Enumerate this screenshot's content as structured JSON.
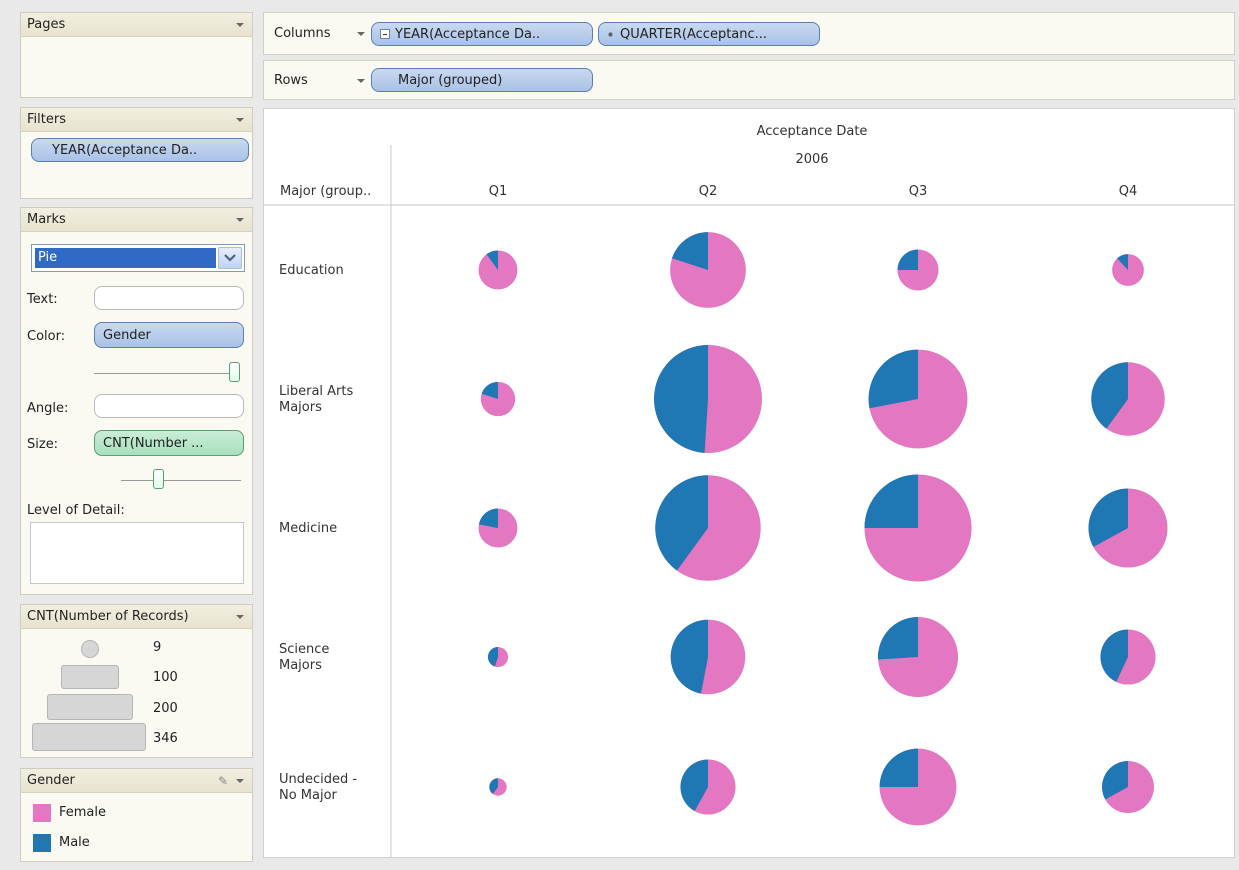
{
  "pages": {
    "title": "Pages"
  },
  "filters": {
    "title": "Filters",
    "pill": "YEAR(Acceptance Da.."
  },
  "marks": {
    "title": "Marks",
    "mark_type": "Pie",
    "text_label": "Text:",
    "color_label": "Color:",
    "color_pill": "Gender",
    "angle_label": "Angle:",
    "size_label": "Size:",
    "size_pill": "CNT(Number ...",
    "lod_label": "Level of Detail:"
  },
  "size_legend": {
    "title": "CNT(Number of Records)",
    "items": [
      "9",
      "100",
      "200",
      "346"
    ]
  },
  "gender_legend": {
    "title": "Gender",
    "items": [
      {
        "label": "Female",
        "color": "#e377c2"
      },
      {
        "label": "Male",
        "color": "#1f77b4"
      }
    ]
  },
  "shelves": {
    "columns_label": "Columns",
    "columns_pills": [
      "YEAR(Acceptance Da..",
      "QUARTER(Acceptanc..."
    ],
    "rows_label": "Rows",
    "rows_pills": [
      "Major (grouped)"
    ]
  },
  "chart_data": {
    "type": "pie",
    "title": "Acceptance Date",
    "year": "2006",
    "row_header": "Major (group..",
    "columns": [
      "Q1",
      "Q2",
      "Q3",
      "Q4"
    ],
    "rows": [
      "Education",
      "Liberal Arts Majors",
      "Medicine",
      "Science Majors",
      "Undecided - No Major"
    ],
    "series_colors": {
      "Female": "#e377c2",
      "Male": "#1f77b4"
    },
    "cells": [
      [
        {
          "count": 45,
          "male_fraction": 0.1
        },
        {
          "count": 170,
          "male_fraction": 0.2
        },
        {
          "count": 50,
          "male_fraction": 0.25
        },
        {
          "count": 30,
          "male_fraction": 0.12
        }
      ],
      [
        {
          "count": 35,
          "male_fraction": 0.2
        },
        {
          "count": 346,
          "male_fraction": 0.49
        },
        {
          "count": 290,
          "male_fraction": 0.28
        },
        {
          "count": 160,
          "male_fraction": 0.4
        }
      ],
      [
        {
          "count": 45,
          "male_fraction": 0.22
        },
        {
          "count": 330,
          "male_fraction": 0.4
        },
        {
          "count": 340,
          "male_fraction": 0.25
        },
        {
          "count": 185,
          "male_fraction": 0.33
        }
      ],
      [
        {
          "count": 12,
          "male_fraction": 0.45
        },
        {
          "count": 165,
          "male_fraction": 0.47
        },
        {
          "count": 190,
          "male_fraction": 0.26
        },
        {
          "count": 90,
          "male_fraction": 0.43
        }
      ],
      [
        {
          "count": 9,
          "male_fraction": 0.4
        },
        {
          "count": 90,
          "male_fraction": 0.42
        },
        {
          "count": 175,
          "male_fraction": 0.25
        },
        {
          "count": 80,
          "male_fraction": 0.33
        }
      ]
    ]
  }
}
